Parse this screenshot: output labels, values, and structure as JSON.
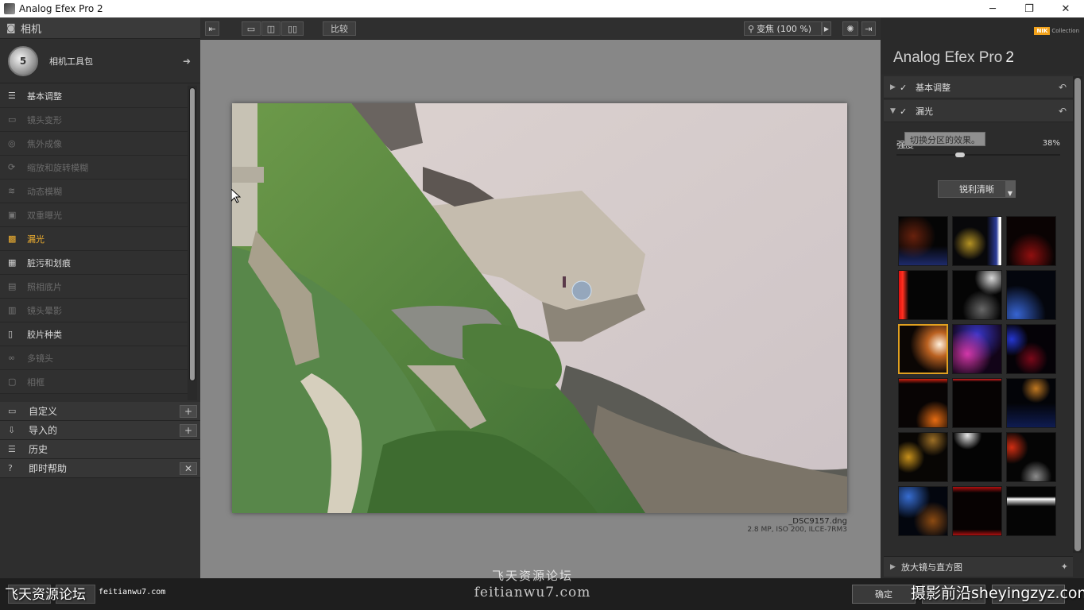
{
  "window": {
    "title": "Analog Efex Pro 2",
    "minimize": "─",
    "maximize": "❐",
    "close": "✕"
  },
  "left_panel": {
    "camera_header": "相机",
    "camera_kit_label": "相机工具包",
    "camera_logo": "5",
    "tools": [
      {
        "label": "基本调整",
        "state": "enabled"
      },
      {
        "label": "镜头变形",
        "state": "disabled"
      },
      {
        "label": "焦外成像",
        "state": "disabled"
      },
      {
        "label": "缩放和旋转模糊",
        "state": "disabled"
      },
      {
        "label": "动态模糊",
        "state": "disabled"
      },
      {
        "label": "双重曝光",
        "state": "disabled"
      },
      {
        "label": "漏光",
        "state": "active"
      },
      {
        "label": "脏污和划痕",
        "state": "enabled"
      },
      {
        "label": "照相底片",
        "state": "disabled"
      },
      {
        "label": "镜头晕影",
        "state": "disabled"
      },
      {
        "label": "胶片种类",
        "state": "enabled"
      },
      {
        "label": "多镜头",
        "state": "disabled"
      },
      {
        "label": "相框",
        "state": "disabled"
      }
    ],
    "sections": [
      {
        "label": "自定义",
        "button": "+"
      },
      {
        "label": "导入的",
        "button": "+"
      },
      {
        "label": "历史",
        "button": ""
      },
      {
        "label": "即时帮助",
        "button": "✕"
      }
    ]
  },
  "toolbar": {
    "compare_label": "比较",
    "zoom_label": "变焦 (100 %)"
  },
  "canvas": {
    "file_name": "_DSC9157.dng",
    "file_meta": "2.8 MP, ISO 200, ILCE-7RM3"
  },
  "right_panel": {
    "brand_badge": "NIK",
    "brand_collection": "Collection",
    "product_name": "Analog Efex Pro",
    "product_version": "2",
    "section_basic": "基本调整",
    "section_light_leak": "漏光",
    "tooltip": "切换分区的效果。",
    "strength_label": "强度",
    "strength_value": "38%",
    "strength_fraction": 0.38,
    "preset_dropdown": "锐利清晰",
    "bottom_section": "放大镜与直方图"
  },
  "bottom_bar": {
    "ok_label": "确定"
  },
  "watermarks": {
    "left_text": "飞天资源论坛",
    "left_url": "feitianwu7.com",
    "center_line1": "飞天资源论坛",
    "center_line2": "feitianwu7.com",
    "right_text": "摄影前沿sheyingzyz.com"
  },
  "colors": {
    "accent": "#f0b030",
    "selected_thumb_border": "#e0a020"
  }
}
